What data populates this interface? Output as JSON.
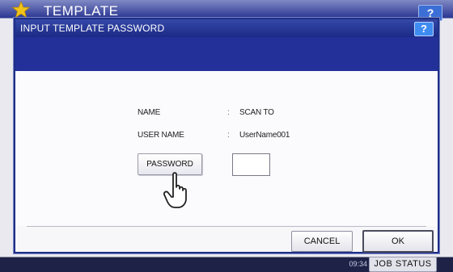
{
  "background": {
    "title": "TEMPLATE",
    "help_label": "?",
    "clock": "09:34",
    "job_status_label": "JOB STATUS"
  },
  "dialog": {
    "title": "INPUT TEMPLATE PASSWORD",
    "help_label": "?",
    "fields": [
      {
        "label": "NAME",
        "value": "SCAN TO"
      },
      {
        "label": "USER NAME",
        "value": "UserName001"
      }
    ],
    "password_button_label": "PASSWORD",
    "password_value": "",
    "cancel_label": "CANCEL",
    "ok_label": "OK"
  },
  "colors": {
    "title_bar": "#1b2a85",
    "band": "#24309a",
    "star": "#f2c21b"
  },
  "icons": [
    "star-icon",
    "help-icon",
    "pointing-hand-icon"
  ]
}
